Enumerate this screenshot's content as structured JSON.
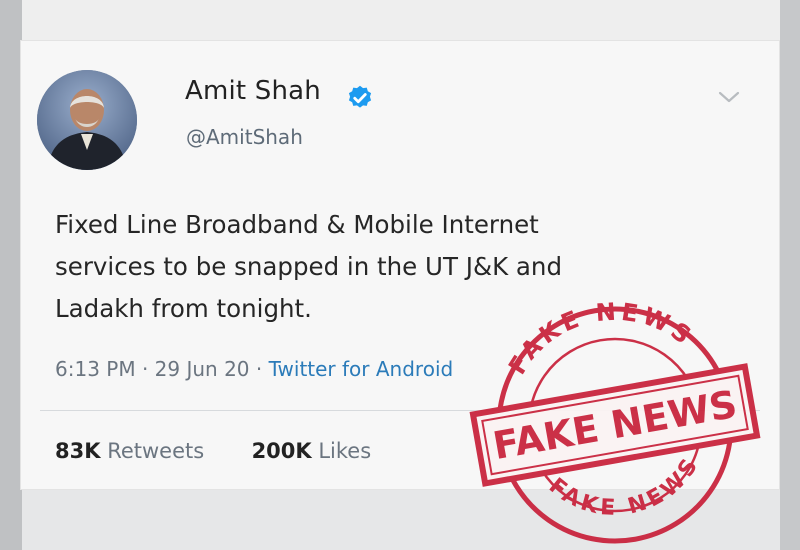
{
  "tweet": {
    "author_name": "Amit Shah",
    "author_handle": "@AmitShah",
    "text": "Fixed Line Broadband & Mobile Internet\nservices to be snapped in the UT J&K and\nLadakh from tonight.",
    "time": "6:13 PM",
    "date": "29 Jun 20",
    "client": "Twitter for Android",
    "retweets": "83K",
    "retweets_label": "Retweets",
    "likes": "200K",
    "likes_label": "Likes"
  },
  "icons": {
    "verified": "verified-badge-icon",
    "menu": "chevron-down-icon"
  },
  "stamp": {
    "main_text": "FAKE NEWS",
    "ring_text_top": "FAKE NEWS",
    "ring_text_bottom": "FAKE NEWS",
    "color": "#c8213a"
  },
  "colors": {
    "link": "#2b7bb9",
    "verified": "#1d9bf0",
    "stamp": "#c8213a"
  }
}
